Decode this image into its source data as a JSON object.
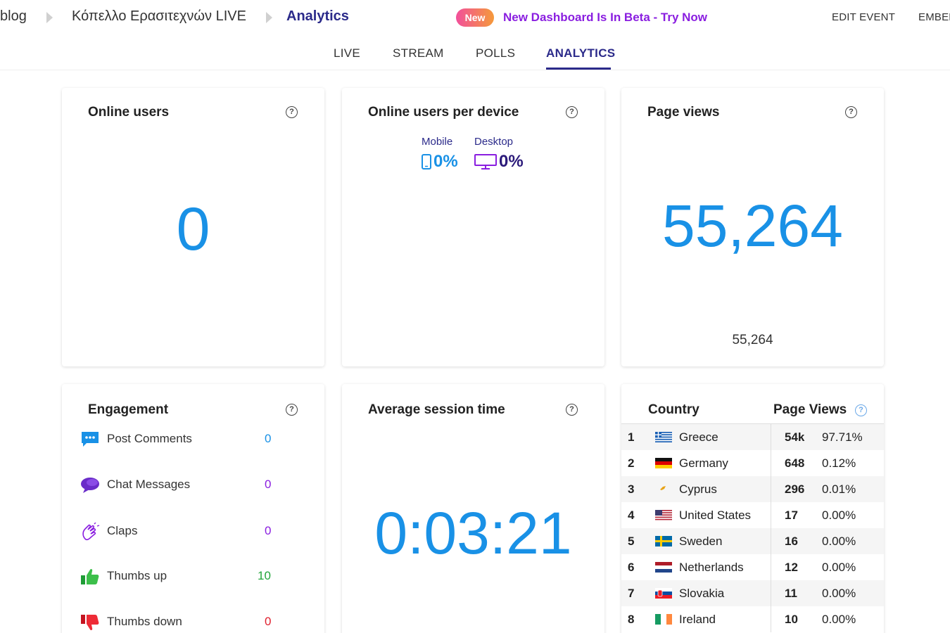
{
  "header": {
    "breadcrumbs": [
      "blog",
      "Κόπελλο Ερασιτεχνών LIVE",
      "Analytics"
    ],
    "new_badge": "New",
    "beta_link": "New Dashboard Is In Beta - Try Now",
    "edit_event": "EDIT EVENT",
    "embed": "EMBEE"
  },
  "tabs": [
    {
      "label": "LIVE",
      "active": false
    },
    {
      "label": "STREAM",
      "active": false
    },
    {
      "label": "POLLS",
      "active": false
    },
    {
      "label": "ANALYTICS",
      "active": true
    }
  ],
  "online_users": {
    "title": "Online users",
    "value": "0"
  },
  "device": {
    "title": "Online users per device",
    "mobile_label": "Mobile",
    "mobile_value": "0%",
    "mobile_color": "#1991e6",
    "desktop_label": "Desktop",
    "desktop_value": "0%",
    "desktop_color": "#2b1a7a",
    "desktop_icon_color": "#8a1ee0"
  },
  "page_views": {
    "title": "Page views",
    "value": "55,264",
    "subvalue": "55,264"
  },
  "engagement": {
    "title": "Engagement",
    "items": [
      {
        "label": "Post Comments",
        "value": "0",
        "icon": "chat-bubble-icon",
        "color": "#1991e6"
      },
      {
        "label": "Chat Messages",
        "value": "0",
        "icon": "speech-bubbles-icon",
        "color": "#8a1ee0"
      },
      {
        "label": "Claps",
        "value": "0",
        "icon": "clap-icon",
        "color": "#8a1ee0"
      },
      {
        "label": "Thumbs up",
        "value": "10",
        "icon": "thumbs-up-icon",
        "color": "#22a53a"
      },
      {
        "label": "Thumbs down",
        "value": "0",
        "icon": "thumbs-down-icon",
        "color": "#e0202e"
      }
    ]
  },
  "session": {
    "title": "Average session time",
    "value": "0:03:21"
  },
  "countries": {
    "col_country": "Country",
    "col_views": "Page Views",
    "rows": [
      {
        "rank": "1",
        "name": "Greece",
        "views": "54k",
        "pct": "97.71%",
        "flag": "greece-flag-icon"
      },
      {
        "rank": "2",
        "name": "Germany",
        "views": "648",
        "pct": "0.12%",
        "flag": "germany-flag-icon"
      },
      {
        "rank": "3",
        "name": "Cyprus",
        "views": "296",
        "pct": "0.01%",
        "flag": "cyprus-flag-icon"
      },
      {
        "rank": "4",
        "name": "United States",
        "views": "17",
        "pct": "0.00%",
        "flag": "usa-flag-icon"
      },
      {
        "rank": "5",
        "name": "Sweden",
        "views": "16",
        "pct": "0.00%",
        "flag": "sweden-flag-icon"
      },
      {
        "rank": "6",
        "name": "Netherlands",
        "views": "12",
        "pct": "0.00%",
        "flag": "netherlands-flag-icon"
      },
      {
        "rank": "7",
        "name": "Slovakia",
        "views": "11",
        "pct": "0.00%",
        "flag": "slovakia-flag-icon"
      },
      {
        "rank": "8",
        "name": "Ireland",
        "views": "10",
        "pct": "0.00%",
        "flag": "ireland-flag-icon"
      }
    ]
  }
}
